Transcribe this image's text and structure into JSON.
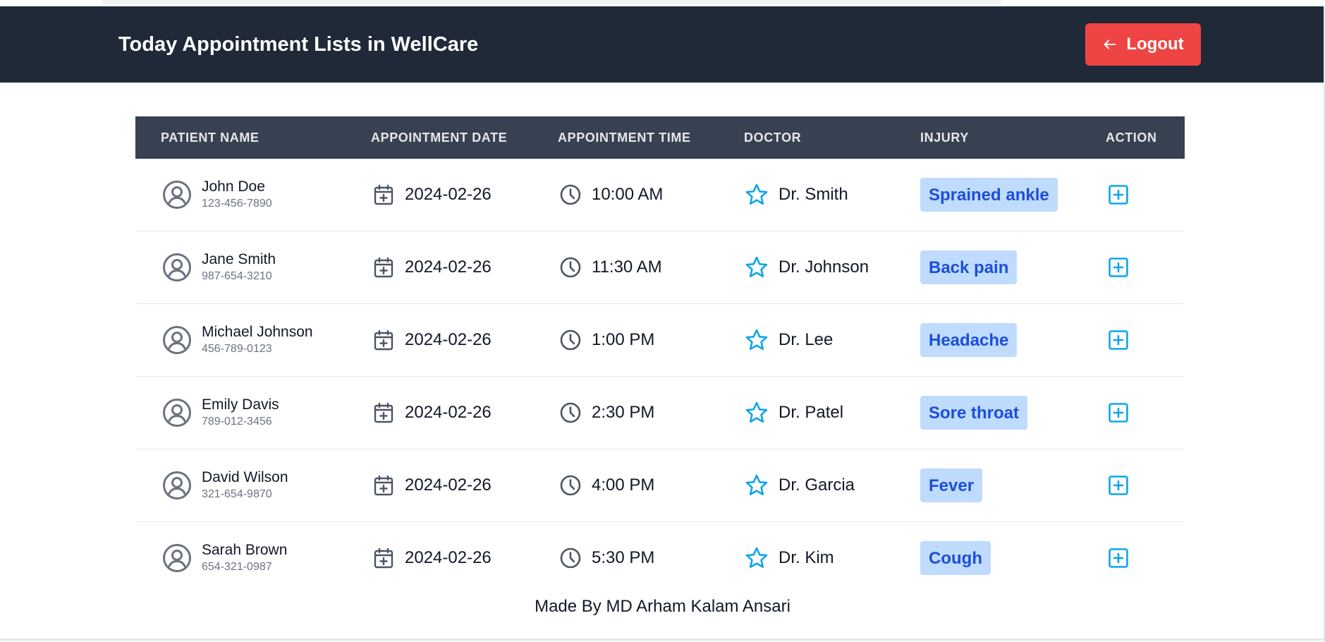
{
  "header": {
    "title": "Today Appointment Lists in WellCare",
    "logout_label": "Logout",
    "logout_icon": "arrow-left-icon",
    "background": "#1f2937",
    "logout_color": "#ef4444"
  },
  "table": {
    "headers": {
      "patient": "PATIENT NAME",
      "date": "APPOINTMENT DATE",
      "time": "APPOINTMENT TIME",
      "doctor": "DOCTOR",
      "injury": "INJURY",
      "action": "ACTION"
    },
    "rows": [
      {
        "name": "John Doe",
        "phone": "123-456-7890",
        "date": "2024-02-26",
        "time": "10:00 AM",
        "doctor": "Dr. Smith",
        "injury": "Sprained ankle"
      },
      {
        "name": "Jane Smith",
        "phone": "987-654-3210",
        "date": "2024-02-26",
        "time": "11:30 AM",
        "doctor": "Dr. Johnson",
        "injury": "Back pain"
      },
      {
        "name": "Michael Johnson",
        "phone": "456-789-0123",
        "date": "2024-02-26",
        "time": "1:00 PM",
        "doctor": "Dr. Lee",
        "injury": "Headache"
      },
      {
        "name": "Emily Davis",
        "phone": "789-012-3456",
        "date": "2024-02-26",
        "time": "2:30 PM",
        "doctor": "Dr. Patel",
        "injury": "Sore throat"
      },
      {
        "name": "David Wilson",
        "phone": "321-654-9870",
        "date": "2024-02-26",
        "time": "4:00 PM",
        "doctor": "Dr. Garcia",
        "injury": "Fever"
      },
      {
        "name": "Sarah Brown",
        "phone": "654-321-0987",
        "date": "2024-02-26",
        "time": "5:30 PM",
        "doctor": "Dr. Kim",
        "injury": "Cough"
      }
    ],
    "icons": {
      "patient": "user-circle-icon",
      "date": "calendar-plus-icon",
      "time": "clock-icon",
      "doctor": "star-icon",
      "action": "plus-square-icon"
    },
    "accent": "#0ea5e9",
    "badge_bg": "#bfdbfe",
    "badge_text": "#1d4ed8"
  },
  "footer": {
    "credit": "Made By MD Arham Kalam Ansari"
  }
}
